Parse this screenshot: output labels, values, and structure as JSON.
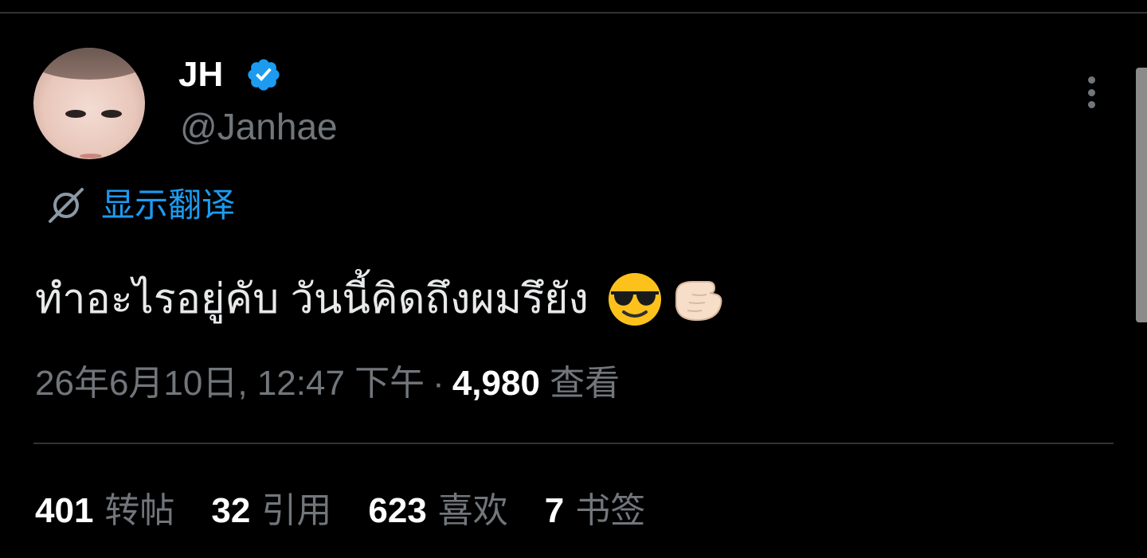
{
  "author": {
    "display_name": "JH",
    "handle": "@Janhae",
    "verified_icon": "verified-badge-icon",
    "verified_color": "#1d9bf0"
  },
  "translate": {
    "label": "显示翻译",
    "icon": "translate-globe-icon"
  },
  "tweet": {
    "text": "ทำอะไรอยู่คับ วันนี้คิดถึงผมรึยัง",
    "emojis": [
      "😎",
      "👉🏻"
    ]
  },
  "meta": {
    "date": "26年6月10日",
    "comma": ",",
    "time": "12:47 下午",
    "separator": "·",
    "views_count": "4,980",
    "views_label": "查看"
  },
  "stats": [
    {
      "count": "401",
      "label": "转帖"
    },
    {
      "count": "32",
      "label": "引用"
    },
    {
      "count": "623",
      "label": "喜欢"
    },
    {
      "count": "7",
      "label": "书签"
    }
  ],
  "colors": {
    "background": "#000000",
    "accent": "#1d9bf0",
    "secondary_text": "#71767b",
    "divider": "#2f3336"
  }
}
